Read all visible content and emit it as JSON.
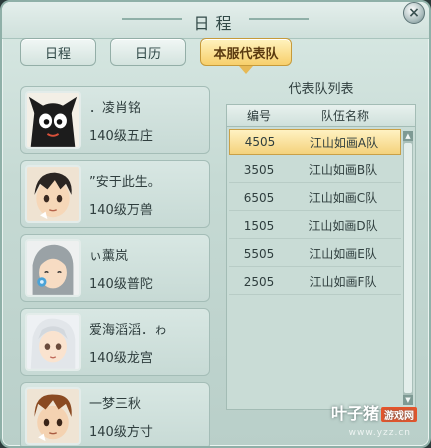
{
  "window": {
    "title": "日程"
  },
  "tabs": [
    {
      "label": "日程",
      "active": false
    },
    {
      "label": "日历",
      "active": false
    },
    {
      "label": "本服代表队",
      "active": true
    }
  ],
  "members": [
    {
      "name": "．凌肖铭",
      "level": "140级五庄",
      "avatar_icon": "black-cat-avatar"
    },
    {
      "name": "”安于此生。",
      "level": "140级万兽",
      "avatar_icon": "dark-hair-boy-avatar"
    },
    {
      "name": "ぃ薰岚",
      "level": "140级普陀",
      "avatar_icon": "gray-hair-girl-avatar"
    },
    {
      "name": "爱海滔滔．ゎ",
      "level": "140级龙宫",
      "avatar_icon": "white-hair-avatar"
    },
    {
      "name": "一梦三秋",
      "level": "140级方寸",
      "avatar_icon": "brown-hair-boy-avatar"
    }
  ],
  "team_list": {
    "title": "代表队列表",
    "columns": {
      "number": "编号",
      "name": "队伍名称"
    },
    "rows": [
      {
        "number": "4505",
        "name": "江山如画A队",
        "selected": true
      },
      {
        "number": "3505",
        "name": "江山如画B队",
        "selected": false
      },
      {
        "number": "6505",
        "name": "江山如画C队",
        "selected": false
      },
      {
        "number": "1505",
        "name": "江山如画D队",
        "selected": false
      },
      {
        "number": "5505",
        "name": "江山如画E队",
        "selected": false
      },
      {
        "number": "2505",
        "name": "江山如画F队",
        "selected": false
      }
    ]
  },
  "watermark": {
    "brand": "叶子猪",
    "tag": "游戏网",
    "url": "www.yzz.cn"
  },
  "colors": {
    "accent": "#f7cf6b",
    "panel": "#c9dcd6",
    "border": "#a3bcb5"
  }
}
